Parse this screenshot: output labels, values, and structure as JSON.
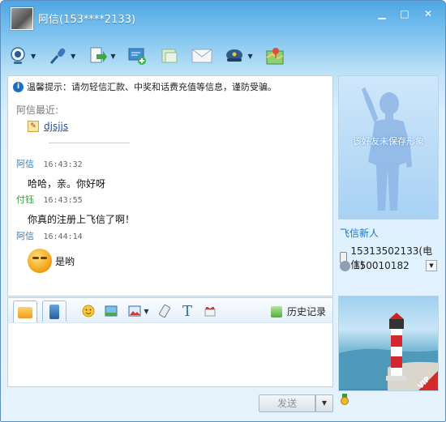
{
  "window": {
    "title": "阿信(153****2133)",
    "controls": {
      "minimize": "▁",
      "maximize": "□",
      "close": "✕"
    }
  },
  "toolbar": {
    "items": [
      {
        "icon": "webcam-icon",
        "has_menu": true
      },
      {
        "icon": "microphone-icon",
        "has_menu": true
      },
      {
        "icon": "send-file-icon",
        "has_menu": true
      },
      {
        "icon": "add-contact-icon",
        "has_menu": false
      },
      {
        "icon": "sms-icon",
        "has_menu": false
      },
      {
        "icon": "mail-icon",
        "has_menu": false
      },
      {
        "icon": "police-hat-icon",
        "has_menu": true
      },
      {
        "icon": "map-pin-icon",
        "has_menu": false
      }
    ]
  },
  "chat": {
    "tip": "温馨提示：请勿轻信汇款、中奖和话费充值等信息，谨防受骗。",
    "recent_label": "阿信最近:",
    "recent_item": "djsjjs",
    "messages": [
      {
        "sender": "阿信",
        "time": "16:43:32",
        "text": "哈哈，亲。你好呀",
        "color": "#2d7fc3"
      },
      {
        "sender": "付钰",
        "time": "16:43:55",
        "text": "你真的注册上飞信了啊！",
        "color": "#3a9b3a"
      },
      {
        "sender": "阿信",
        "time": "16:44:14",
        "text": "是哟",
        "emoji": "pursed-smile-emoji",
        "color": "#2d7fc3"
      }
    ]
  },
  "input_toolbar": {
    "history_label": "历史记录"
  },
  "send": {
    "label": "发送"
  },
  "contact": {
    "portrait_text": "该好友未保存形象",
    "nickname": "飞信新人",
    "phone": "15313502133(电信)",
    "fetion_id": "150010182"
  },
  "ad": {
    "badge": "VIP"
  },
  "colors": {
    "accent": "#1f73c0",
    "title_bar": "#4ea6e3"
  }
}
